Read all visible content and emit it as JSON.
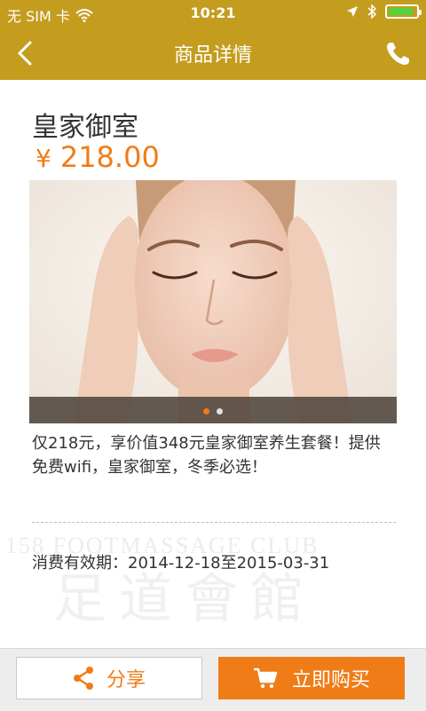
{
  "status_bar": {
    "carrier": "无 SIM 卡",
    "time": "10:21",
    "battery_level": 0.9,
    "icons": [
      "wifi-icon",
      "location-arrow-icon",
      "bluetooth-icon",
      "battery-icon"
    ]
  },
  "nav": {
    "title": "商品详情",
    "back_icon": "chevron-left-icon",
    "phone_icon": "phone-icon"
  },
  "product": {
    "name": "皇家御室",
    "currency": "¥",
    "price": "218.00",
    "description": "仅218元，享价值348元皇家御室养生套餐！提供免费wifi，皇家御室，冬季必选！",
    "validity": "消费有效期：2014-12-18至2015-03-31"
  },
  "slider": {
    "total": 2,
    "active_index": 0,
    "active_color": "#f07c17",
    "inactive_color": "#e0e0e0"
  },
  "watermark": {
    "line1": "158 FOOTMASSAGE CLUB",
    "line2": "足道會館"
  },
  "bottom_bar": {
    "share_label": "分享",
    "buy_label": "立即购买"
  },
  "colors": {
    "brand": "#c49d1f",
    "accent": "#f07c17"
  }
}
